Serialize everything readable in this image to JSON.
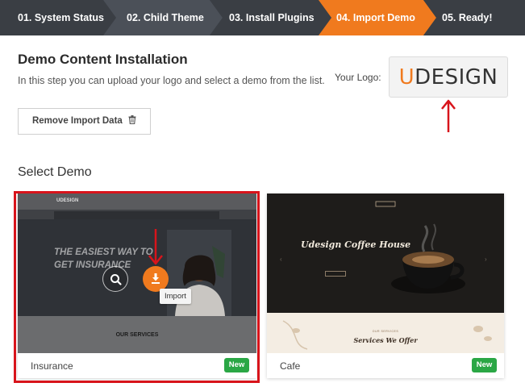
{
  "steps": [
    {
      "label": "01. System Status",
      "active": false
    },
    {
      "label": "02. Child Theme",
      "active": false
    },
    {
      "label": "03. Install Plugins",
      "active": false
    },
    {
      "label": "04. Import Demo",
      "active": true
    },
    {
      "label": "05. Ready!",
      "active": false
    }
  ],
  "colors": {
    "step_dark": "#3a3e44",
    "step_mid": "#4b5058",
    "accent": "#f07a1e",
    "badge_green": "#2aa745",
    "highlight_red": "#d8141b"
  },
  "header": {
    "title": "Demo Content Installation",
    "subtitle": "In this step you can upload your logo and select a demo from the list."
  },
  "logo": {
    "label": "Your Logo:",
    "text_first": "U",
    "text_rest": "DESIGN"
  },
  "actions": {
    "remove_label": "Remove Import Data"
  },
  "select_demo": {
    "title": "Select Demo",
    "demos": [
      {
        "name": "Insurance",
        "badge": "New",
        "tooltip": "Import",
        "thumb": {
          "logo": "UDESIGN",
          "headline_1": "THE EASIEST WAY TO",
          "headline_2": "GET INSURANCE",
          "services": "OUR SERVICES"
        }
      },
      {
        "name": "Cafe",
        "badge": "New",
        "thumb": {
          "title": "Udesign Coffee House",
          "services_sub": "OUR SERVICES",
          "services": "Services We Offer"
        }
      }
    ]
  }
}
